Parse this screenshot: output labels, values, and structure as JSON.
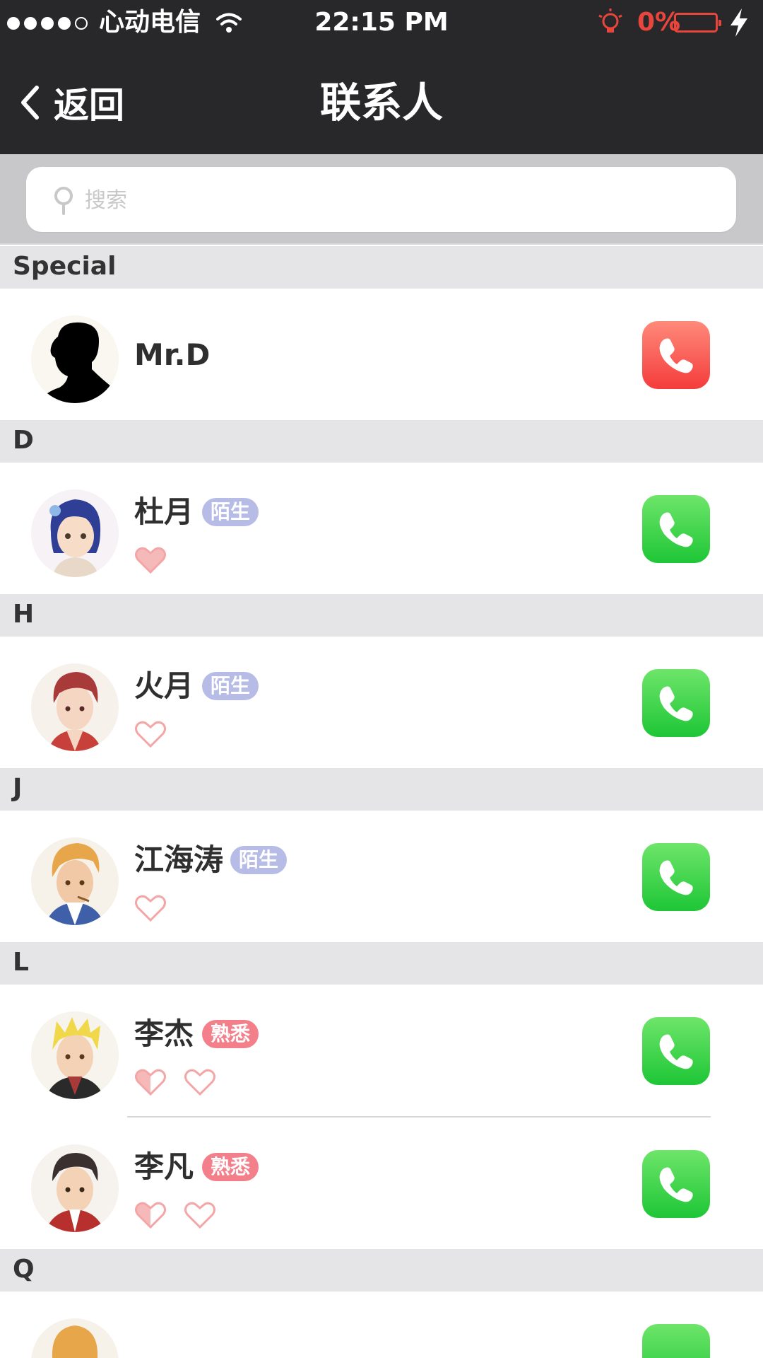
{
  "status_bar": {
    "carrier": "心动电信",
    "time": "22:15 PM",
    "battery_percent": "0%",
    "signal_bars_filled": 4,
    "signal_bars_total": 5
  },
  "nav": {
    "back_label": "返回",
    "title": "联系人"
  },
  "search": {
    "placeholder": "搜索",
    "value": ""
  },
  "colors": {
    "nav_background": "#28282b",
    "accent_red": "#e8453c",
    "call_green": "#1ec636",
    "call_red": "#f43c3c",
    "badge_stranger": "#b7bce6",
    "badge_familiar": "#f27f8a",
    "heart": "#f4a6a6"
  },
  "sections": [
    {
      "header": "Special",
      "contacts": [
        {
          "name": "Mr.D",
          "badge": "",
          "hearts": [],
          "call_color": "red",
          "avatar": "silhouette-avatar"
        }
      ]
    },
    {
      "header": "D",
      "contacts": [
        {
          "name": "杜月",
          "badge": "陌生",
          "badge_type": "stranger",
          "hearts": [
            "filled"
          ],
          "call_color": "green",
          "avatar": "blue-hair-girl-avatar"
        }
      ]
    },
    {
      "header": "H",
      "contacts": [
        {
          "name": "火月",
          "badge": "陌生",
          "badge_type": "stranger",
          "hearts": [
            "empty"
          ],
          "call_color": "green",
          "avatar": "red-hair-boy-avatar"
        }
      ]
    },
    {
      "header": "J",
      "contacts": [
        {
          "name": "江海涛",
          "badge": "陌生",
          "badge_type": "stranger",
          "hearts": [
            "empty"
          ],
          "call_color": "green",
          "avatar": "blond-man-avatar"
        }
      ]
    },
    {
      "header": "L",
      "contacts": [
        {
          "name": "李杰",
          "badge": "熟悉",
          "badge_type": "familiar",
          "hearts": [
            "half",
            "empty"
          ],
          "call_color": "green",
          "avatar": "yellow-hair-boy-avatar"
        },
        {
          "name": "李凡",
          "badge": "熟悉",
          "badge_type": "familiar",
          "hearts": [
            "half",
            "empty"
          ],
          "call_color": "green",
          "avatar": "dark-hair-boy-avatar"
        }
      ]
    },
    {
      "header": "Q",
      "contacts": []
    }
  ]
}
